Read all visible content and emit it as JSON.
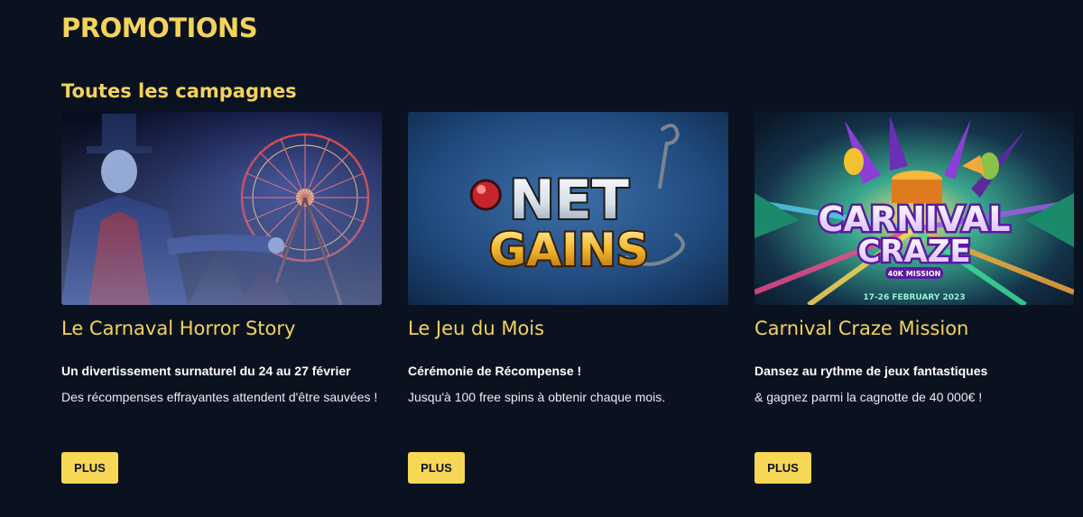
{
  "page": {
    "title": "PROMOTIONS",
    "section_title": "Toutes les campagnes"
  },
  "colors": {
    "background": "#0b121f",
    "accent": "#f3d35b",
    "button": "#f7d756",
    "text": "#ffffff"
  },
  "promotions": [
    {
      "title": "Le Carnaval Horror Story",
      "subtitle": "Un divertissement surnaturel du 24 au 27 février",
      "description": "Des récompenses effrayantes attendent d'être sauvées !",
      "button_label": "PLUS",
      "image": "horror-carnival-banner"
    },
    {
      "title": "Le Jeu du Mois",
      "subtitle": "Cérémonie de Récompense !",
      "description": "Jusqu'à 100 free spins à obtenir chaque mois.",
      "button_label": "PLUS",
      "image": "net-gains-banner",
      "image_text": [
        "NET",
        "GAINS"
      ]
    },
    {
      "title": "Carnival Craze Mission",
      "subtitle": "Dansez au rythme de jeux fantastiques",
      "description": "& gagnez parmi la cagnotte de 40 000€ !",
      "button_label": "PLUS",
      "image": "carnival-craze-banner",
      "image_text": [
        "CARNIVAL",
        "CRAZE",
        "40K MISSION",
        "17-26 FEBRUARY 2023"
      ]
    }
  ]
}
